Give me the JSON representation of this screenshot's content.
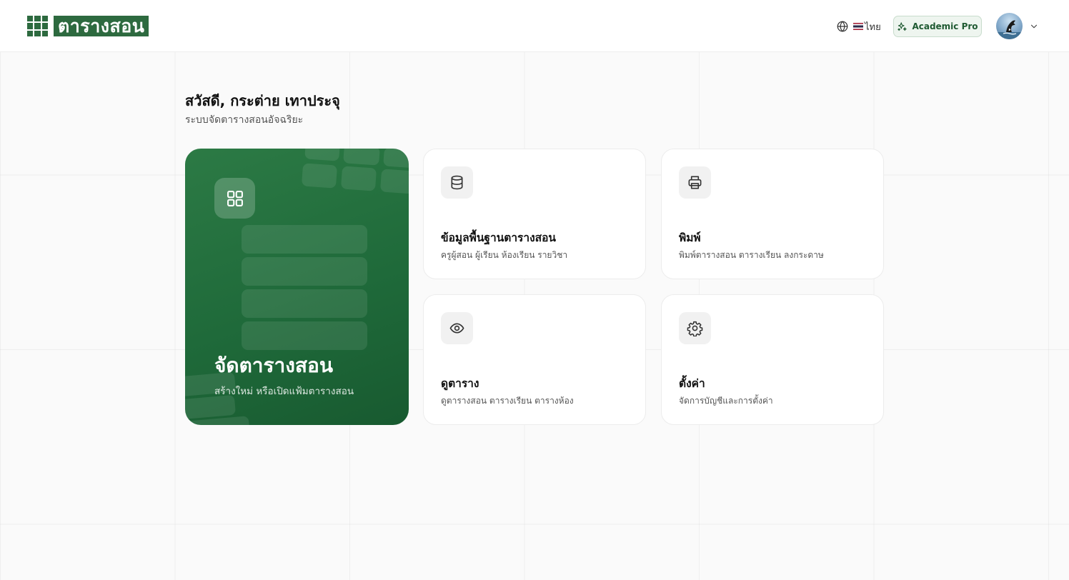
{
  "header": {
    "logo_text": "ตารางสอน",
    "language_label": "ไทย",
    "plan_label": "Academic Pro"
  },
  "greeting": {
    "title": "สวัสดี, กระต่าย เทาประจุ",
    "subtitle": "ระบบจัดตารางสอนอัจฉริยะ"
  },
  "hero": {
    "icon": "grid-icon",
    "title": "จัดตารางสอน",
    "subtitle": "สร้างใหม่ หรือเปิดแฟ้มตารางสอน"
  },
  "cards": [
    {
      "icon": "database-icon",
      "title": "ข้อมูลพื้นฐานตารางสอน",
      "description": "ครูผู้สอน ผู้เรียน ห้องเรียน รายวิชา"
    },
    {
      "icon": "printer-icon",
      "title": "พิมพ์",
      "description": "พิมพ์ตารางสอน ตารางเรียน ลงกระดาษ"
    },
    {
      "icon": "eye-icon",
      "title": "ดูตาราง",
      "description": "ดูตารางสอน ตารางเรียน ตารางห้อง"
    },
    {
      "icon": "gear-icon",
      "title": "ตั้งค่า",
      "description": "จัดการบัญชีและการตั้งค่า"
    }
  ],
  "colors": {
    "brand_green": "#2d6a3f",
    "hero_green": "#1f6a3a",
    "badge_bg": "#eef5ef"
  }
}
